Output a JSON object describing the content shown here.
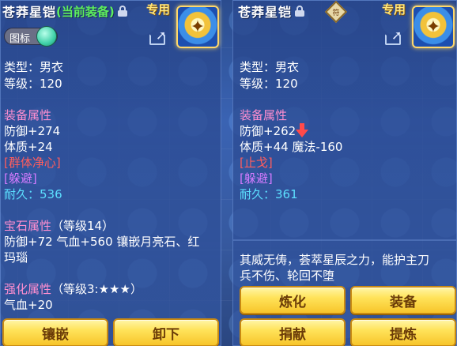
{
  "left_panel": {
    "item_name": "苍莽星铠",
    "equipped_tag": "(当前装备)",
    "exclusive": "专用",
    "icon_toggle_label": "图标",
    "type_line": "类型：男衣",
    "level_line": "等级：120",
    "equip_attr_header": "装备属性",
    "defense": "防御+274",
    "constitution": "体质+24",
    "special_skill": "[群体净心]",
    "special_effect": "[躲避]",
    "durability": "耐久：536",
    "gem_header": "宝石属性",
    "gem_level": "（等级14）",
    "gem_line1": "防御+72 气血+560 镶嵌月亮石、红",
    "gem_line2": "玛瑙",
    "enhance_header": "强化属性",
    "enhance_level": "（等级3:★★★）",
    "enhance_line1": "气血+20",
    "buttons": [
      "镶嵌",
      "卸下"
    ]
  },
  "right_panel": {
    "item_name": "苍莽星铠",
    "exclusive": "专用",
    "type_line": "类型：男衣",
    "level_line": "等级：120",
    "equip_attr_header": "装备属性",
    "defense": "防御+262",
    "constitution_magic": "体质+44 魔法-160",
    "special_skill": "[止戈]",
    "special_effect": "[躲避]",
    "durability": "耐久：361",
    "description_line1": "其威无俦，荟萃星辰之力，能护主刀",
    "description_line2": "兵不伤、轮回不堕",
    "buttons": [
      "炼化",
      "装备",
      "捐献",
      "提炼"
    ]
  }
}
